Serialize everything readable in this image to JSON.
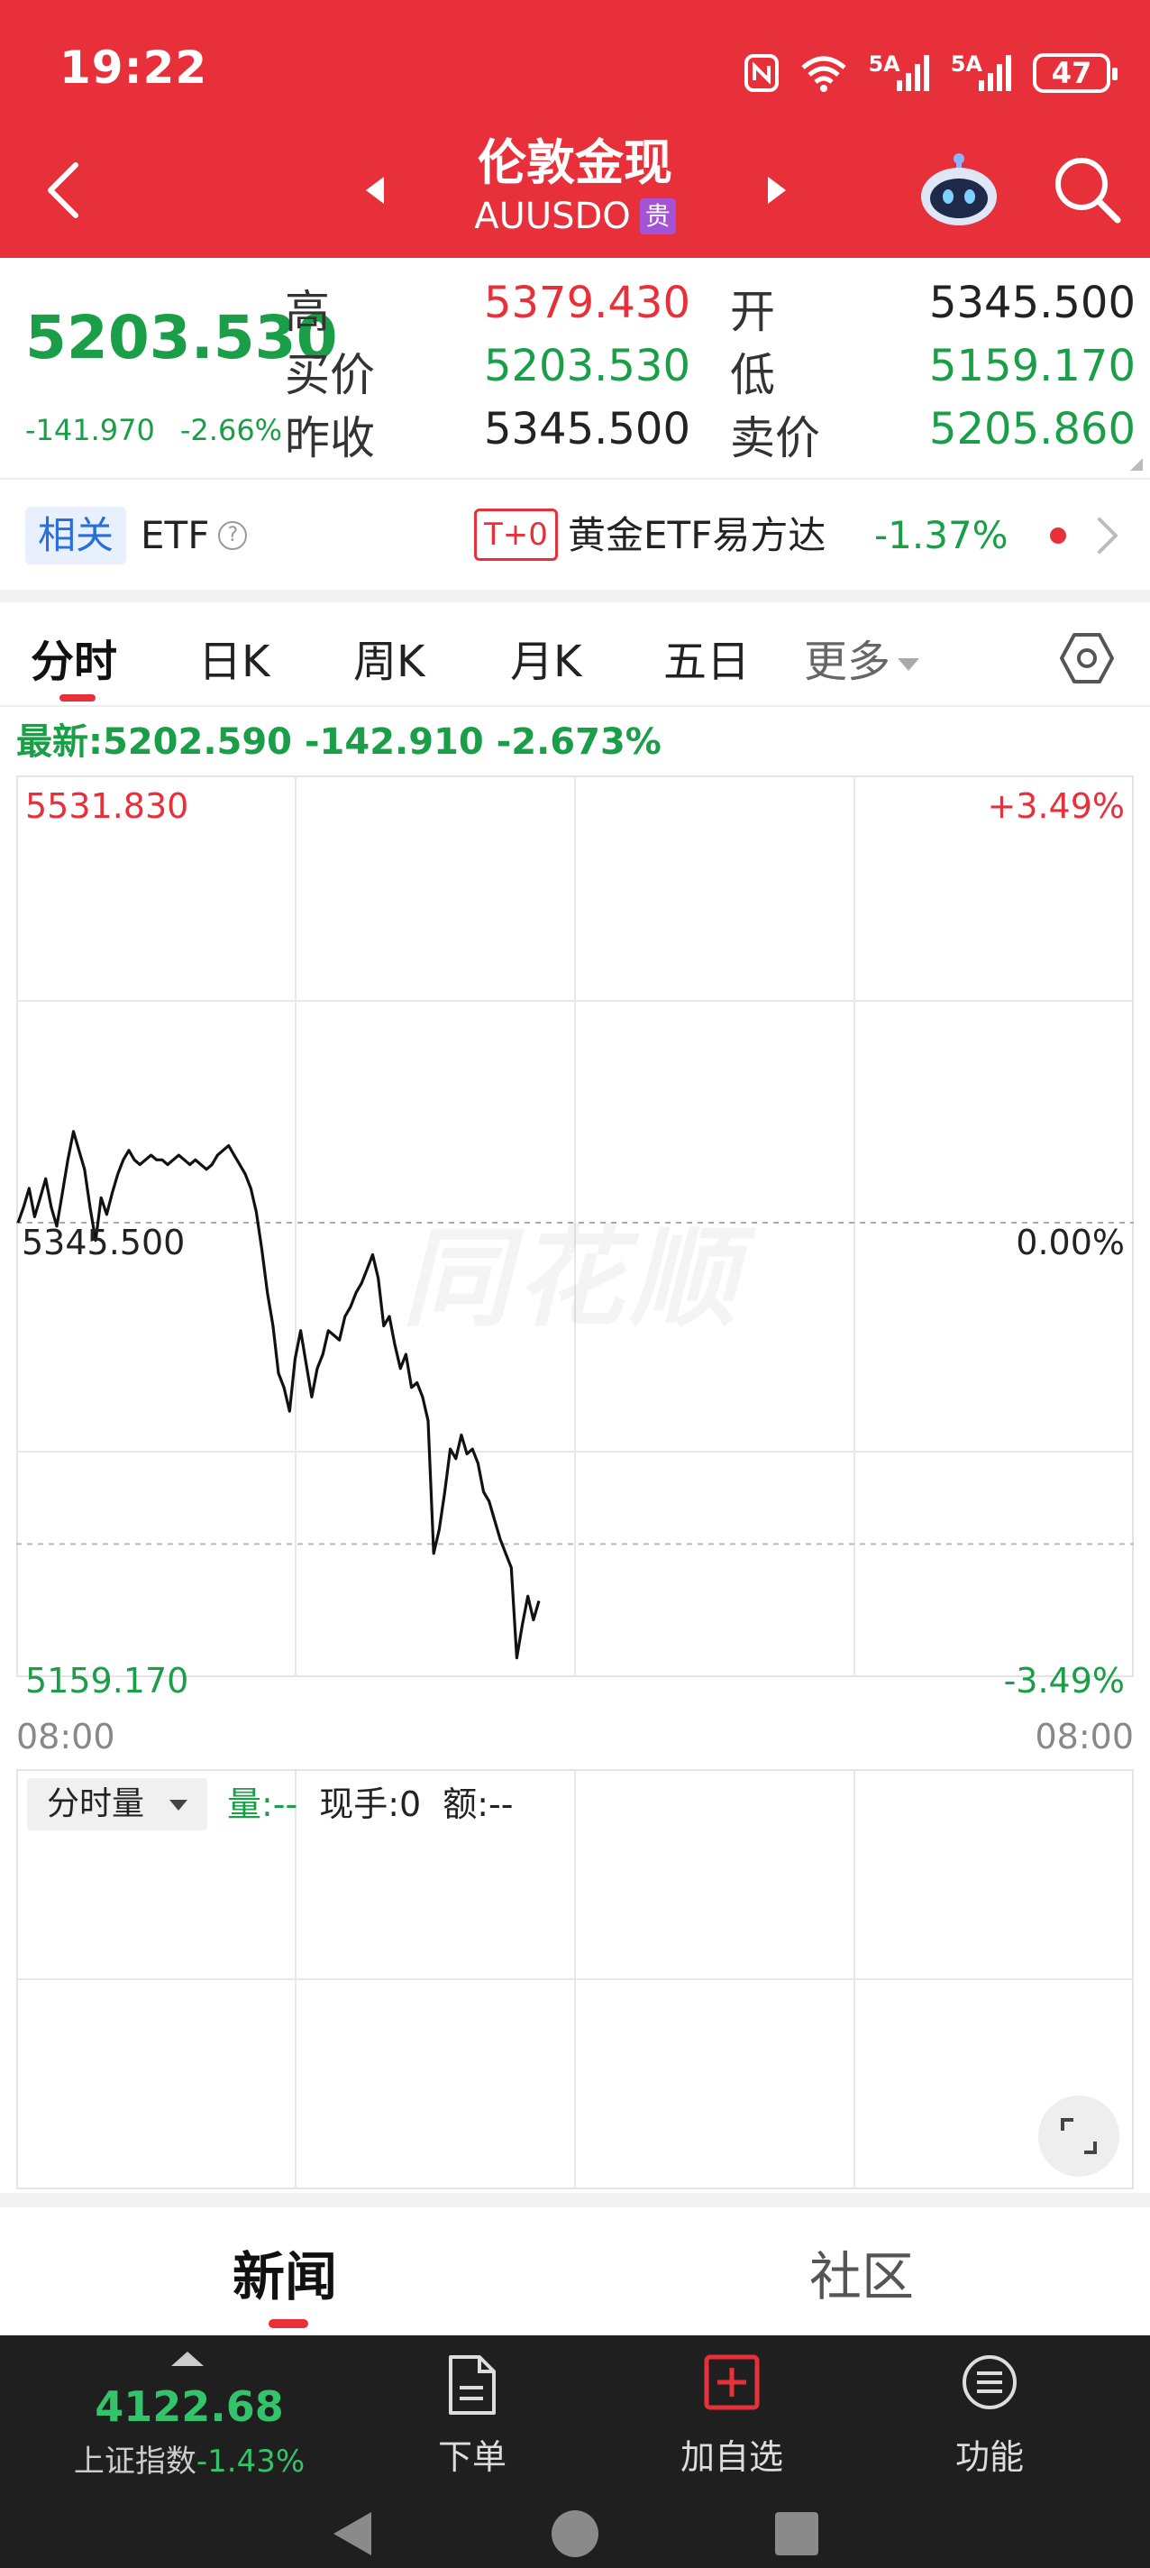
{
  "status": {
    "time": "19:22",
    "net1": "5A",
    "net2": "5A",
    "battery": "47"
  },
  "header": {
    "title": "伦敦金现",
    "code": "AUUSDO",
    "tag": "贵"
  },
  "quote": {
    "price": "5203.530",
    "change": "-141.970",
    "change_pct": "-2.66%",
    "rows": [
      {
        "l1": "高",
        "v1": "5379.430",
        "l2": "开",
        "v2": "5345.500"
      },
      {
        "l1": "买价",
        "v1": "5203.530",
        "l2": "低",
        "v2": "5159.170"
      },
      {
        "l1": "昨收",
        "v1": "5345.500",
        "l2": "卖价",
        "v2": "5205.860"
      }
    ]
  },
  "related": {
    "tag": "相关",
    "etf_label": "ETF",
    "help": "?",
    "badge": "T+0",
    "etf_name": "黄金ETF易方达",
    "etf_change": "-1.37%"
  },
  "tabs": [
    "分时",
    "日K",
    "周K",
    "月K",
    "五日",
    "更多"
  ],
  "chart": {
    "latest": "最新:5202.590 -142.910 -2.673%",
    "y_max": "5531.830",
    "y_mid": "5345.500",
    "y_min": "5159.170",
    "pct_max": "+3.49%",
    "pct_mid": "0.00%",
    "pct_min": "-3.49%",
    "time_start": "08:00",
    "time_end": "08:00",
    "watermark": "同花顺",
    "colors": {
      "up": "#e8303a",
      "down": "#1a9e47",
      "line": "#111111"
    }
  },
  "chart_data": {
    "type": "line",
    "title": "",
    "xlabel": "",
    "ylabel": "",
    "ylim": [
      5159.17,
      5531.83
    ],
    "baseline": 5345.5,
    "x_range": [
      "08:00",
      "08:00"
    ],
    "series": [
      {
        "values": [
          5345.5,
          5352,
          5360,
          5348,
          5356,
          5364,
          5352,
          5344,
          5358,
          5372,
          5384,
          5376,
          5368,
          5352,
          5338,
          5356,
          5349,
          5358,
          5366,
          5372,
          5376,
          5372,
          5370,
          5372,
          5374,
          5372,
          5372,
          5370,
          5372,
          5374,
          5372,
          5370,
          5372,
          5370,
          5368,
          5370,
          5374,
          5376,
          5378,
          5374,
          5370,
          5366,
          5360,
          5350,
          5334,
          5316,
          5302,
          5282,
          5276,
          5266,
          5288,
          5300,
          5286,
          5272,
          5284,
          5290,
          5300,
          5298,
          5296,
          5306,
          5310,
          5316,
          5320,
          5326,
          5332,
          5322,
          5302,
          5306,
          5294,
          5284,
          5290,
          5276,
          5278,
          5272,
          5262,
          5206,
          5216,
          5232,
          5250,
          5246,
          5256,
          5248,
          5250,
          5244,
          5232,
          5228,
          5220,
          5212,
          5206,
          5200,
          5162,
          5176,
          5188,
          5178,
          5186
        ]
      }
    ]
  },
  "volume": {
    "selector": "分时量",
    "vol": "量:--",
    "hand": "现手:0",
    "amount": "额:--"
  },
  "news_tabs": [
    "新闻",
    "社区"
  ],
  "dock": {
    "index_value": "4122.68",
    "index_name": "上证指数",
    "index_change": "-1.43%",
    "buttons": [
      "下单",
      "加自选",
      "功能"
    ]
  }
}
